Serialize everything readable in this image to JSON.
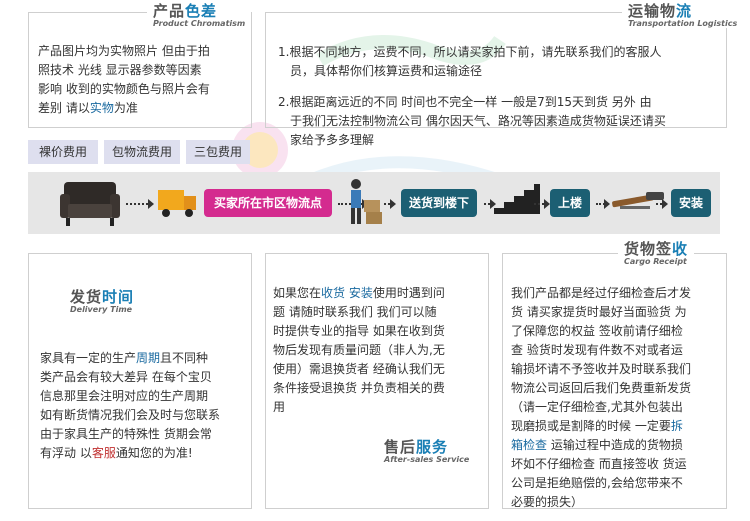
{
  "color_panel": {
    "title_prefix": "产品",
    "title_highlight": "色差",
    "title_en": "Product Chromatism",
    "lines": [
      "产品图片均为实物照片 但由于拍",
      "照技术 光线 显示器参数等因素",
      "影响 收到的实物颜色与照片会有",
      "差别 请以"
    ],
    "line4_highlight": "实物",
    "line4_tail": "为准"
  },
  "transport_panel": {
    "title_prefix": "运输物",
    "title_highlight": "流",
    "title_en": "Transportation Logistics",
    "item1_line1": "1.根据不同地方，运费不同，所以请买家拍下前，请先联系我们的客服人",
    "item1_line2": "员，具体帮你们核算运费和运输途径",
    "item2_line1": "2.根据距离远近的不同 时间也不完全一样 一般是7到15天到货 另外 由",
    "item2_line2": "于我们无法控制物流公司 偶尔因天气、路况等因素造成货物延误还请买",
    "item2_line3": "家给予多多理解"
  },
  "tabs": [
    "裸价费用",
    "包物流费用",
    "三包费用"
  ],
  "flow": {
    "step1": "买家所在市区物流点",
    "step2": "送货到楼下",
    "step3": "上楼",
    "step4": "安装"
  },
  "delivery_panel": {
    "title_prefix": "发货",
    "title_highlight": "时间",
    "title_en": "Delivery Time",
    "l1a": "家具有一定的生产",
    "l1h": "周期",
    "l1b": "且不同种",
    "l2": "类产品会有较大差异 在每个宝贝",
    "l3": "信息那里会注明对应的生产周期",
    "l4": "如有断货情况我们会及时与您联系",
    "l5": "由于家具生产的特殊性 货期会常",
    "l6a": "有浮动 以",
    "l6h": "客服",
    "l6b": "通知您的为准!"
  },
  "service_panel": {
    "title_prefix": "售后",
    "title_highlight": "服务",
    "title_en": "After-sales Service",
    "l1a": "如果您在",
    "l1h1": "收货",
    "l1h2": "安装",
    "l1b": "使用时遇到问",
    "l2": "题 请随时联系我们 我们可以随",
    "l3": "时提供专业的指导 如果在收到货",
    "l4": "物后发现有质量问题（非人为,无",
    "l5": "使用）需退换货者 经确认我们无",
    "l6": "条件接受退换货 并负责相关的费",
    "l7": "用"
  },
  "signing_panel": {
    "title_prefix": "货物签",
    "title_highlight": "收",
    "title_en": "Cargo Receipt",
    "l1": "我们产品都是经过仔细检查后才发",
    "l2": "货 请买家提货时最好当面验货 为",
    "l3": "了保障您的权益 签收前请仔细检",
    "l4": "查 验货时发现有件数不对或者运",
    "l5": "输损坏请不予签收并及时联系我们",
    "l6": "物流公司返回后我们免费重新发货",
    "l7": "（请一定仔细检查,尤其外包装出",
    "l8a": "现磨损或是割降的时候 一定要",
    "l8h": "拆",
    "l9h": "箱检查",
    "l9b": " 运输过程中造成的货物损",
    "l10": "坏如不仔细检查 而直接签收 货运",
    "l11": "公司是拒绝赔偿的,会给您带来不",
    "l12": "必要的损失）"
  },
  "colors": {
    "accent_blue": "#1a7fb5",
    "pink": "#d42b8f",
    "teal": "#1c5f73",
    "tab_bg": "#dedfef"
  }
}
